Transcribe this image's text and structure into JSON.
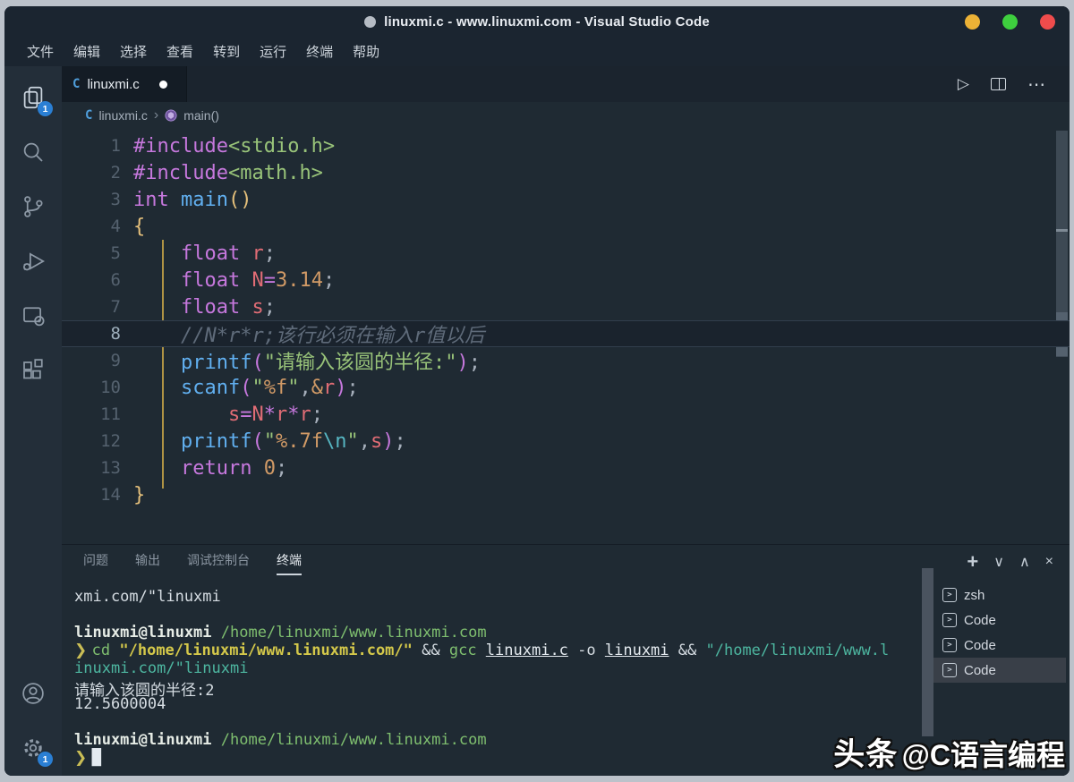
{
  "window": {
    "title": "linuxmi.c - www.linuxmi.com - Visual Studio Code",
    "controls": {
      "minimize_color": "#ecb236",
      "maximize_color": "#3ecf3e",
      "close_color": "#ef4c4c"
    }
  },
  "menubar": {
    "items": [
      "文件",
      "编辑",
      "选择",
      "查看",
      "转到",
      "运行",
      "终端",
      "帮助"
    ]
  },
  "activity_bar": {
    "explorer_badge": "1",
    "settings_badge": "1",
    "items": [
      "explorer",
      "search",
      "source-control",
      "run-and-debug",
      "remote-explorer",
      "extensions"
    ],
    "bottom_items": [
      "account",
      "settings"
    ]
  },
  "editor": {
    "tab": {
      "file_icon": "C",
      "label": "linuxmi.c"
    },
    "actions": {
      "run": "▷",
      "more": "⋯"
    },
    "breadcrumb": {
      "file_icon": "C",
      "file": "linuxmi.c",
      "separator": "›",
      "symbol": "main()"
    },
    "code": {
      "lines": [
        {
          "tokens": [
            [
              "kw",
              "#include"
            ],
            [
              "str",
              "<stdio.h>"
            ]
          ]
        },
        {
          "tokens": [
            [
              "kw",
              "#include"
            ],
            [
              "str",
              "<math.h>"
            ]
          ]
        },
        {
          "tokens": [
            [
              "kw",
              "int"
            ],
            [
              "pln",
              " "
            ],
            [
              "fn",
              "main"
            ],
            [
              "brk",
              "()"
            ]
          ]
        },
        {
          "tokens": [
            [
              "brk",
              "{"
            ]
          ]
        },
        {
          "tokens": [
            [
              "pln",
              "    "
            ],
            [
              "kw",
              "float"
            ],
            [
              "pln",
              " "
            ],
            [
              "var",
              "r"
            ],
            [
              "pun",
              ";"
            ]
          ]
        },
        {
          "tokens": [
            [
              "pln",
              "    "
            ],
            [
              "kw",
              "float"
            ],
            [
              "pln",
              " "
            ],
            [
              "var",
              "N"
            ],
            [
              "op",
              "="
            ],
            [
              "num",
              "3.14"
            ],
            [
              "pun",
              ";"
            ]
          ]
        },
        {
          "tokens": [
            [
              "pln",
              "    "
            ],
            [
              "kw",
              "float"
            ],
            [
              "pln",
              " "
            ],
            [
              "var",
              "s"
            ],
            [
              "pun",
              ";"
            ]
          ]
        },
        {
          "current": true,
          "tokens": [
            [
              "pln",
              "    "
            ],
            [
              "cmt",
              "//N*r*r;该行必须在输入r值以后"
            ]
          ]
        },
        {
          "tokens": [
            [
              "pln",
              "    "
            ],
            [
              "fn",
              "printf"
            ],
            [
              "op2",
              "("
            ],
            [
              "str",
              "\"请输入该圆的半径:\""
            ],
            [
              "op2",
              ")"
            ],
            [
              "pun",
              ";"
            ]
          ]
        },
        {
          "tokens": [
            [
              "pln",
              "    "
            ],
            [
              "fn",
              "scanf"
            ],
            [
              "op2",
              "("
            ],
            [
              "str",
              "\""
            ],
            [
              "num",
              "%f"
            ],
            [
              "str",
              "\""
            ],
            [
              "pun",
              ","
            ],
            [
              "num",
              "&"
            ],
            [
              "var",
              "r"
            ],
            [
              "op2",
              ")"
            ],
            [
              "pun",
              ";"
            ]
          ]
        },
        {
          "tokens": [
            [
              "pln",
              "        "
            ],
            [
              "var",
              "s"
            ],
            [
              "op",
              "="
            ],
            [
              "var",
              "N"
            ],
            [
              "op",
              "*"
            ],
            [
              "var",
              "r"
            ],
            [
              "op",
              "*"
            ],
            [
              "var",
              "r"
            ],
            [
              "pun",
              ";"
            ]
          ]
        },
        {
          "tokens": [
            [
              "pln",
              "    "
            ],
            [
              "fn",
              "printf"
            ],
            [
              "op2",
              "("
            ],
            [
              "str",
              "\""
            ],
            [
              "num",
              "%.7f"
            ],
            [
              "esc",
              "\\n"
            ],
            [
              "str",
              "\""
            ],
            [
              "pun",
              ","
            ],
            [
              "var",
              "s"
            ],
            [
              "op2",
              ")"
            ],
            [
              "pun",
              ";"
            ]
          ]
        },
        {
          "tokens": [
            [
              "pln",
              "    "
            ],
            [
              "kw",
              "return"
            ],
            [
              "pln",
              " "
            ],
            [
              "num",
              "0"
            ],
            [
              "pun",
              ";"
            ]
          ]
        },
        {
          "tokens": [
            [
              "brk",
              "}"
            ]
          ]
        }
      ]
    }
  },
  "panel": {
    "tabs": [
      {
        "label": "问题",
        "active": false
      },
      {
        "label": "输出",
        "active": false
      },
      {
        "label": "调试控制台",
        "active": false
      },
      {
        "label": "终端",
        "active": true
      }
    ],
    "toolbar": {
      "new_terminal": "+",
      "dropdown": "∨",
      "maximize": "∧",
      "close": "×"
    },
    "terminal": {
      "lines": [
        {
          "tokens": [
            [
              "fg",
              "xmi.com/\"linuxmi"
            ]
          ]
        },
        {
          "tokens": []
        },
        {
          "tokens": [
            [
              "user",
              "linuxmi@linuxmi"
            ],
            [
              "fg",
              " "
            ],
            [
              "path",
              "/home/linuxmi/www.linuxmi.com"
            ]
          ]
        },
        {
          "tokens": [
            [
              "prompt",
              "❯ "
            ],
            [
              "grn",
              "cd "
            ],
            [
              "yel",
              "\"/home/linuxmi/www.linuxmi.com/\""
            ],
            [
              "fg",
              " && "
            ],
            [
              "grn",
              "gcc "
            ],
            [
              "und",
              "linuxmi.c"
            ],
            [
              "fg",
              " -o "
            ],
            [
              "und",
              "linuxmi"
            ],
            [
              "fg",
              " && "
            ],
            [
              "teal",
              "\"/home/linuxmi/www.l"
            ]
          ]
        },
        {
          "tokens": [
            [
              "teal",
              "inuxmi.com/\"linuxmi"
            ]
          ]
        },
        {
          "tokens": [
            [
              "fg",
              "请输入该圆的半径:2"
            ]
          ]
        },
        {
          "tokens": [
            [
              "fg",
              "12.5600004"
            ]
          ]
        },
        {
          "tokens": []
        },
        {
          "tokens": [
            [
              "user",
              "linuxmi@linuxmi"
            ],
            [
              "fg",
              " "
            ],
            [
              "path",
              "/home/linuxmi/www.linuxmi.com"
            ]
          ]
        },
        {
          "tokens": [
            [
              "prompt",
              "❯ "
            ],
            [
              "cursor",
              "█"
            ]
          ]
        }
      ]
    },
    "terminal_list": [
      {
        "icon": ">",
        "label": "zsh",
        "selected": false
      },
      {
        "icon": ">",
        "label": "Code",
        "selected": false
      },
      {
        "icon": ">",
        "label": "Code",
        "selected": false
      },
      {
        "icon": ">",
        "label": "Code",
        "selected": true
      }
    ]
  },
  "watermark": {
    "brand": "头条",
    "handle": "@C语言编程"
  },
  "colors": {
    "editor_bg": "#1f2a33",
    "titlebar_bg": "#1b2530",
    "tabstrip_bg": "#1b242e",
    "active_tab_bg": "#141c25",
    "activitybar_bg": "#232e39",
    "badge_blue": "#2a7fd4",
    "keyword": "#c678dd",
    "function": "#61afef",
    "string": "#98c379",
    "number": "#d19a66",
    "variable": "#e06c75",
    "bracket": "#e5c07b",
    "comment": "#5f6b7a",
    "terminal_green": "#7fbf6f",
    "terminal_yellow": "#d4c84a",
    "terminal_teal": "#4db6a0"
  }
}
